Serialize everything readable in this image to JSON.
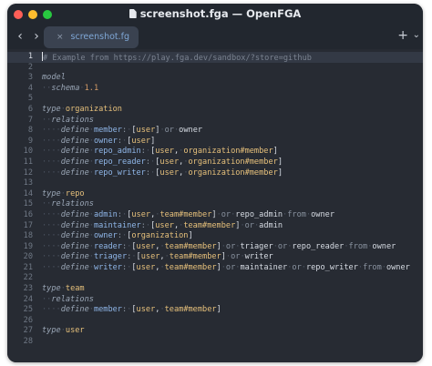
{
  "window": {
    "title": "screenshot.fga — OpenFGA"
  },
  "tabs": [
    {
      "label": "screenshot.fg",
      "close": "×"
    }
  ],
  "toolbar": {
    "back": "‹",
    "forward": "›",
    "plus": "+",
    "chevron": "⌄"
  },
  "editor": {
    "current_line": 1,
    "lines": [
      {
        "n": "1",
        "tokens": [
          {
            "c": "cm",
            "t": "# Example from https://play.fga.dev/sandbox/?store=github"
          }
        ]
      },
      {
        "n": "2",
        "tokens": []
      },
      {
        "n": "3",
        "tokens": [
          {
            "c": "kw",
            "t": "model"
          }
        ]
      },
      {
        "n": "4",
        "tokens": [
          {
            "c": "ws",
            "t": "··"
          },
          {
            "c": "kw",
            "t": "schema"
          },
          {
            "c": "ws",
            "t": "·"
          },
          {
            "c": "num",
            "t": "1.1"
          }
        ]
      },
      {
        "n": "5",
        "tokens": []
      },
      {
        "n": "6",
        "tokens": [
          {
            "c": "kw",
            "t": "type"
          },
          {
            "c": "ws",
            "t": "·"
          },
          {
            "c": "nm",
            "t": "organization"
          }
        ]
      },
      {
        "n": "7",
        "tokens": [
          {
            "c": "ws",
            "t": "··"
          },
          {
            "c": "kw",
            "t": "relations"
          }
        ]
      },
      {
        "n": "8",
        "tokens": [
          {
            "c": "ws",
            "t": "····"
          },
          {
            "c": "kw",
            "t": "define"
          },
          {
            "c": "ws",
            "t": "·"
          },
          {
            "c": "rl",
            "t": "member"
          },
          {
            "c": "op",
            "t": ":"
          },
          {
            "c": "ws",
            "t": "·"
          },
          {
            "c": "ty",
            "t": "["
          },
          {
            "c": "rf",
            "t": "user"
          },
          {
            "c": "ty",
            "t": "]"
          },
          {
            "c": "ws",
            "t": "·"
          },
          {
            "c": "op",
            "t": "or"
          },
          {
            "c": "ws",
            "t": "·"
          },
          {
            "c": "ty",
            "t": "owner"
          }
        ]
      },
      {
        "n": "9",
        "tokens": [
          {
            "c": "ws",
            "t": "····"
          },
          {
            "c": "kw",
            "t": "define"
          },
          {
            "c": "ws",
            "t": "·"
          },
          {
            "c": "rl",
            "t": "owner"
          },
          {
            "c": "op",
            "t": ":"
          },
          {
            "c": "ws",
            "t": "·"
          },
          {
            "c": "ty",
            "t": "["
          },
          {
            "c": "rf",
            "t": "user"
          },
          {
            "c": "ty",
            "t": "]"
          }
        ]
      },
      {
        "n": "10",
        "tokens": [
          {
            "c": "ws",
            "t": "····"
          },
          {
            "c": "kw",
            "t": "define"
          },
          {
            "c": "ws",
            "t": "·"
          },
          {
            "c": "rl",
            "t": "repo_admin"
          },
          {
            "c": "op",
            "t": ":"
          },
          {
            "c": "ws",
            "t": "·"
          },
          {
            "c": "ty",
            "t": "["
          },
          {
            "c": "rf",
            "t": "user"
          },
          {
            "c": "ty",
            "t": ","
          },
          {
            "c": "ws",
            "t": "·"
          },
          {
            "c": "rf",
            "t": "organization#member"
          },
          {
            "c": "ty",
            "t": "]"
          }
        ]
      },
      {
        "n": "11",
        "tokens": [
          {
            "c": "ws",
            "t": "····"
          },
          {
            "c": "kw",
            "t": "define"
          },
          {
            "c": "ws",
            "t": "·"
          },
          {
            "c": "rl",
            "t": "repo_reader"
          },
          {
            "c": "op",
            "t": ":"
          },
          {
            "c": "ws",
            "t": "·"
          },
          {
            "c": "ty",
            "t": "["
          },
          {
            "c": "rf",
            "t": "user"
          },
          {
            "c": "ty",
            "t": ","
          },
          {
            "c": "ws",
            "t": "·"
          },
          {
            "c": "rf",
            "t": "organization#member"
          },
          {
            "c": "ty",
            "t": "]"
          }
        ]
      },
      {
        "n": "12",
        "tokens": [
          {
            "c": "ws",
            "t": "····"
          },
          {
            "c": "kw",
            "t": "define"
          },
          {
            "c": "ws",
            "t": "·"
          },
          {
            "c": "rl",
            "t": "repo_writer"
          },
          {
            "c": "op",
            "t": ":"
          },
          {
            "c": "ws",
            "t": "·"
          },
          {
            "c": "ty",
            "t": "["
          },
          {
            "c": "rf",
            "t": "user"
          },
          {
            "c": "ty",
            "t": ","
          },
          {
            "c": "ws",
            "t": "·"
          },
          {
            "c": "rf",
            "t": "organization#member"
          },
          {
            "c": "ty",
            "t": "]"
          }
        ]
      },
      {
        "n": "13",
        "tokens": []
      },
      {
        "n": "14",
        "tokens": [
          {
            "c": "kw",
            "t": "type"
          },
          {
            "c": "ws",
            "t": "·"
          },
          {
            "c": "nm",
            "t": "repo"
          }
        ]
      },
      {
        "n": "15",
        "tokens": [
          {
            "c": "ws",
            "t": "··"
          },
          {
            "c": "kw",
            "t": "relations"
          }
        ]
      },
      {
        "n": "16",
        "tokens": [
          {
            "c": "ws",
            "t": "····"
          },
          {
            "c": "kw",
            "t": "define"
          },
          {
            "c": "ws",
            "t": "·"
          },
          {
            "c": "rl",
            "t": "admin"
          },
          {
            "c": "op",
            "t": ":"
          },
          {
            "c": "ws",
            "t": "·"
          },
          {
            "c": "ty",
            "t": "["
          },
          {
            "c": "rf",
            "t": "user"
          },
          {
            "c": "ty",
            "t": ","
          },
          {
            "c": "ws",
            "t": "·"
          },
          {
            "c": "rf",
            "t": "team#member"
          },
          {
            "c": "ty",
            "t": "]"
          },
          {
            "c": "ws",
            "t": "·"
          },
          {
            "c": "op",
            "t": "or"
          },
          {
            "c": "ws",
            "t": "·"
          },
          {
            "c": "ty",
            "t": "repo_admin"
          },
          {
            "c": "ws",
            "t": "·"
          },
          {
            "c": "op",
            "t": "from"
          },
          {
            "c": "ws",
            "t": "·"
          },
          {
            "c": "ty",
            "t": "owner"
          }
        ]
      },
      {
        "n": "17",
        "tokens": [
          {
            "c": "ws",
            "t": "····"
          },
          {
            "c": "kw",
            "t": "define"
          },
          {
            "c": "ws",
            "t": "·"
          },
          {
            "c": "rl",
            "t": "maintainer"
          },
          {
            "c": "op",
            "t": ":"
          },
          {
            "c": "ws",
            "t": "·"
          },
          {
            "c": "ty",
            "t": "["
          },
          {
            "c": "rf",
            "t": "user"
          },
          {
            "c": "ty",
            "t": ","
          },
          {
            "c": "ws",
            "t": "·"
          },
          {
            "c": "rf",
            "t": "team#member"
          },
          {
            "c": "ty",
            "t": "]"
          },
          {
            "c": "ws",
            "t": "·"
          },
          {
            "c": "op",
            "t": "or"
          },
          {
            "c": "ws",
            "t": "·"
          },
          {
            "c": "ty",
            "t": "admin"
          }
        ]
      },
      {
        "n": "18",
        "tokens": [
          {
            "c": "ws",
            "t": "····"
          },
          {
            "c": "kw",
            "t": "define"
          },
          {
            "c": "ws",
            "t": "·"
          },
          {
            "c": "rl",
            "t": "owner"
          },
          {
            "c": "op",
            "t": ":"
          },
          {
            "c": "ws",
            "t": "·"
          },
          {
            "c": "ty",
            "t": "["
          },
          {
            "c": "rf",
            "t": "organization"
          },
          {
            "c": "ty",
            "t": "]"
          }
        ]
      },
      {
        "n": "19",
        "tokens": [
          {
            "c": "ws",
            "t": "····"
          },
          {
            "c": "kw",
            "t": "define"
          },
          {
            "c": "ws",
            "t": "·"
          },
          {
            "c": "rl",
            "t": "reader"
          },
          {
            "c": "op",
            "t": ":"
          },
          {
            "c": "ws",
            "t": "·"
          },
          {
            "c": "ty",
            "t": "["
          },
          {
            "c": "rf",
            "t": "user"
          },
          {
            "c": "ty",
            "t": ","
          },
          {
            "c": "ws",
            "t": "·"
          },
          {
            "c": "rf",
            "t": "team#member"
          },
          {
            "c": "ty",
            "t": "]"
          },
          {
            "c": "ws",
            "t": "·"
          },
          {
            "c": "op",
            "t": "or"
          },
          {
            "c": "ws",
            "t": "·"
          },
          {
            "c": "ty",
            "t": "triager"
          },
          {
            "c": "ws",
            "t": "·"
          },
          {
            "c": "op",
            "t": "or"
          },
          {
            "c": "ws",
            "t": "·"
          },
          {
            "c": "ty",
            "t": "repo_reader"
          },
          {
            "c": "ws",
            "t": "·"
          },
          {
            "c": "op",
            "t": "from"
          },
          {
            "c": "ws",
            "t": "·"
          },
          {
            "c": "ty",
            "t": "owner"
          }
        ]
      },
      {
        "n": "20",
        "tokens": [
          {
            "c": "ws",
            "t": "····"
          },
          {
            "c": "kw",
            "t": "define"
          },
          {
            "c": "ws",
            "t": "·"
          },
          {
            "c": "rl",
            "t": "triager"
          },
          {
            "c": "op",
            "t": ":"
          },
          {
            "c": "ws",
            "t": "·"
          },
          {
            "c": "ty",
            "t": "["
          },
          {
            "c": "rf",
            "t": "user"
          },
          {
            "c": "ty",
            "t": ","
          },
          {
            "c": "ws",
            "t": "·"
          },
          {
            "c": "rf",
            "t": "team#member"
          },
          {
            "c": "ty",
            "t": "]"
          },
          {
            "c": "ws",
            "t": "·"
          },
          {
            "c": "op",
            "t": "or"
          },
          {
            "c": "ws",
            "t": "·"
          },
          {
            "c": "ty",
            "t": "writer"
          }
        ]
      },
      {
        "n": "21",
        "tokens": [
          {
            "c": "ws",
            "t": "····"
          },
          {
            "c": "kw",
            "t": "define"
          },
          {
            "c": "ws",
            "t": "·"
          },
          {
            "c": "rl",
            "t": "writer"
          },
          {
            "c": "op",
            "t": ":"
          },
          {
            "c": "ws",
            "t": "·"
          },
          {
            "c": "ty",
            "t": "["
          },
          {
            "c": "rf",
            "t": "user"
          },
          {
            "c": "ty",
            "t": ","
          },
          {
            "c": "ws",
            "t": "·"
          },
          {
            "c": "rf",
            "t": "team#member"
          },
          {
            "c": "ty",
            "t": "]"
          },
          {
            "c": "ws",
            "t": "·"
          },
          {
            "c": "op",
            "t": "or"
          },
          {
            "c": "ws",
            "t": "·"
          },
          {
            "c": "ty",
            "t": "maintainer"
          },
          {
            "c": "ws",
            "t": "·"
          },
          {
            "c": "op",
            "t": "or"
          },
          {
            "c": "ws",
            "t": "·"
          },
          {
            "c": "ty",
            "t": "repo_writer"
          },
          {
            "c": "ws",
            "t": "·"
          },
          {
            "c": "op",
            "t": "from"
          },
          {
            "c": "ws",
            "t": "·"
          },
          {
            "c": "ty",
            "t": "owner"
          }
        ]
      },
      {
        "n": "22",
        "tokens": []
      },
      {
        "n": "23",
        "tokens": [
          {
            "c": "kw",
            "t": "type"
          },
          {
            "c": "ws",
            "t": "·"
          },
          {
            "c": "nm",
            "t": "team"
          }
        ]
      },
      {
        "n": "24",
        "tokens": [
          {
            "c": "ws",
            "t": "··"
          },
          {
            "c": "kw",
            "t": "relations"
          }
        ]
      },
      {
        "n": "25",
        "tokens": [
          {
            "c": "ws",
            "t": "····"
          },
          {
            "c": "kw",
            "t": "define"
          },
          {
            "c": "ws",
            "t": "·"
          },
          {
            "c": "rl",
            "t": "member"
          },
          {
            "c": "op",
            "t": ":"
          },
          {
            "c": "ws",
            "t": "·"
          },
          {
            "c": "ty",
            "t": "["
          },
          {
            "c": "rf",
            "t": "user"
          },
          {
            "c": "ty",
            "t": ","
          },
          {
            "c": "ws",
            "t": "·"
          },
          {
            "c": "rf",
            "t": "team#member"
          },
          {
            "c": "ty",
            "t": "]"
          }
        ]
      },
      {
        "n": "26",
        "tokens": []
      },
      {
        "n": "27",
        "tokens": [
          {
            "c": "kw",
            "t": "type"
          },
          {
            "c": "ws",
            "t": "·"
          },
          {
            "c": "nm",
            "t": "user"
          }
        ]
      },
      {
        "n": "28",
        "tokens": []
      }
    ]
  },
  "colors": {
    "window_bg": "#22272f",
    "editor_bg": "#272b33",
    "current_line_bg": "#333945",
    "tab_bg": "#3a4250",
    "tab_text": "#7fa7d6",
    "close_dot": "#ff5f57",
    "minimize_dot": "#febc2e",
    "zoom_dot": "#28c840"
  }
}
